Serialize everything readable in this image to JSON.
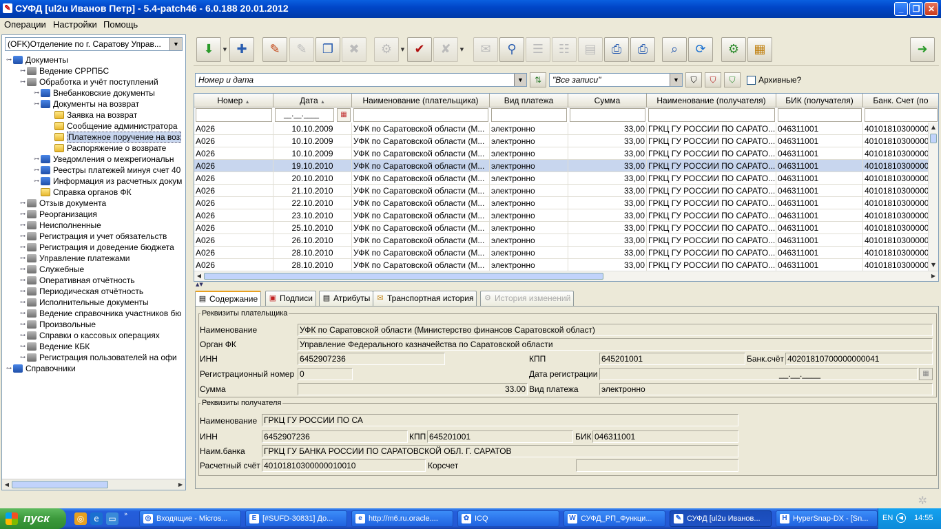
{
  "window": {
    "title": "СУФД [ul2u Иванов Петр] - 5.4-patch46 - 6.0.188 20.01.2012"
  },
  "menu": [
    "Операции",
    "Настройки",
    "Помощь"
  ],
  "left_panel": {
    "org_select": "(OFK)Отделение по г. Саратову Управ...",
    "tree": [
      {
        "label": "Документы",
        "level": 0,
        "icon": "doc"
      },
      {
        "label": "Ведение СРРПБС",
        "level": 1,
        "icon": "grp"
      },
      {
        "label": "Обработка и учёт поступлений",
        "level": 1,
        "icon": "grp"
      },
      {
        "label": "Внебанковские документы",
        "level": 2,
        "icon": "doc"
      },
      {
        "label": "Документы на возврат",
        "level": 2,
        "icon": "doc"
      },
      {
        "label": "Заявка на возврат",
        "level": 3,
        "icon": "folder"
      },
      {
        "label": "Сообщение администратора",
        "level": 3,
        "icon": "folder"
      },
      {
        "label": "Платежное поручение на воз",
        "level": 3,
        "icon": "folder",
        "selected": true
      },
      {
        "label": "Распоряжение о возврате",
        "level": 3,
        "icon": "folder"
      },
      {
        "label": "Уведомления о межрегиональн",
        "level": 2,
        "icon": "doc"
      },
      {
        "label": "Реестры платежей минуя счет 40",
        "level": 2,
        "icon": "doc"
      },
      {
        "label": "Информация из расчетных докум",
        "level": 2,
        "icon": "doc"
      },
      {
        "label": "Справка органов ФК",
        "level": 2,
        "icon": "folder"
      },
      {
        "label": "Отзыв документа",
        "level": 1,
        "icon": "grp"
      },
      {
        "label": "Реорганизация",
        "level": 1,
        "icon": "grp"
      },
      {
        "label": "Неисполненные",
        "level": 1,
        "icon": "grp"
      },
      {
        "label": "Регистрация и учет обязательств",
        "level": 1,
        "icon": "grp"
      },
      {
        "label": "Регистрация и доведение бюджета",
        "level": 1,
        "icon": "grp"
      },
      {
        "label": "Управление платежами",
        "level": 1,
        "icon": "grp"
      },
      {
        "label": "Служебные",
        "level": 1,
        "icon": "grp"
      },
      {
        "label": "Оперативная отчётность",
        "level": 1,
        "icon": "grp"
      },
      {
        "label": "Периодическая отчётность",
        "level": 1,
        "icon": "grp"
      },
      {
        "label": "Исполнительные документы",
        "level": 1,
        "icon": "grp"
      },
      {
        "label": "Ведение справочника участников бю",
        "level": 1,
        "icon": "grp"
      },
      {
        "label": "Произвольные",
        "level": 1,
        "icon": "grp"
      },
      {
        "label": "Справки о кассовых операциях",
        "level": 1,
        "icon": "grp"
      },
      {
        "label": "Ведение КБК",
        "level": 1,
        "icon": "grp"
      },
      {
        "label": "Регистрация пользователей на офи",
        "level": 1,
        "icon": "grp"
      },
      {
        "label": "Справочники",
        "level": 0,
        "icon": "doc"
      }
    ]
  },
  "filter": {
    "sort_combo": "Номер и дата",
    "records_combo": "\"Все записи\"",
    "archive_label": "Архивные?",
    "date_placeholder": "__.__.____"
  },
  "table": {
    "columns": [
      "Номер",
      "Дата",
      "Наименование (плательщика)",
      "Вид платежа",
      "Сумма",
      "Наименование (получателя)",
      "БИК (получателя)",
      "Банк. Счет (по"
    ],
    "rows": [
      [
        "А026",
        "10.10.2009",
        "УФК по Саратовской области (М...",
        "электронно",
        "33,00",
        "ГРКЦ ГУ РОССИИ ПО САРАТО...",
        "046311001",
        "40101810300000"
      ],
      [
        "А026",
        "10.10.2009",
        "УФК по Саратовской области (М...",
        "электронно",
        "33,00",
        "ГРКЦ ГУ РОССИИ ПО САРАТО...",
        "046311001",
        "40101810300000"
      ],
      [
        "А026",
        "10.10.2009",
        "УФК по Саратовской области (М...",
        "электронно",
        "33,00",
        "ГРКЦ ГУ РОССИИ ПО САРАТО...",
        "046311001",
        "40101810300000"
      ],
      [
        "А026",
        "19.10.2010",
        "УФК по Саратовской области (М...",
        "электронно",
        "33,00",
        "ГРКЦ ГУ РОССИИ ПО САРАТО...",
        "046311001",
        "40101810300000"
      ],
      [
        "А026",
        "20.10.2010",
        "УФК по Саратовской области (М...",
        "электронно",
        "33,00",
        "ГРКЦ ГУ РОССИИ ПО САРАТО...",
        "046311001",
        "40101810300000"
      ],
      [
        "А026",
        "21.10.2010",
        "УФК по Саратовской области (М...",
        "электронно",
        "33,00",
        "ГРКЦ ГУ РОССИИ ПО САРАТО...",
        "046311001",
        "40101810300000"
      ],
      [
        "А026",
        "22.10.2010",
        "УФК по Саратовской области (М...",
        "электронно",
        "33,00",
        "ГРКЦ ГУ РОССИИ ПО САРАТО...",
        "046311001",
        "40101810300000"
      ],
      [
        "А026",
        "23.10.2010",
        "УФК по Саратовской области (М...",
        "электронно",
        "33,00",
        "ГРКЦ ГУ РОССИИ ПО САРАТО...",
        "046311001",
        "40101810300000"
      ],
      [
        "А026",
        "25.10.2010",
        "УФК по Саратовской области (М...",
        "электронно",
        "33,00",
        "ГРКЦ ГУ РОССИИ ПО САРАТО...",
        "046311001",
        "40101810300000"
      ],
      [
        "А026",
        "26.10.2010",
        "УФК по Саратовской области (М...",
        "электронно",
        "33,00",
        "ГРКЦ ГУ РОССИИ ПО САРАТО...",
        "046311001",
        "40101810300000"
      ],
      [
        "А026",
        "28.10.2010",
        "УФК по Саратовской области (М...",
        "электронно",
        "33,00",
        "ГРКЦ ГУ РОССИИ ПО САРАТО...",
        "046311001",
        "40101810300000"
      ],
      [
        "А026",
        "28.10.2010",
        "УФК по Саратовской области (М...",
        "электронно",
        "33,00",
        "ГРКЦ ГУ РОССИИ ПО САРАТО...",
        "046311001",
        "40101810300000"
      ]
    ],
    "selected_row": 3
  },
  "tabs": [
    "Содержание",
    "Подписи",
    "Атрибуты",
    "Транспортная история",
    "История изменений"
  ],
  "payer": {
    "legend": "Реквизиты плательщика",
    "name_label": "Наименование",
    "name": "УФК по Саратовской области (Министерство финансов Саратовской област)",
    "org_label": "Орган ФК",
    "org": "Управление Федерального казначейства по Саратовской области",
    "inn_label": "ИНН",
    "inn": "6452907236",
    "kpp_label": "КПП",
    "kpp": "645201001",
    "account_label": "Банк.счёт",
    "account": "40201810700000000041",
    "regnum_label": "Регистрационный номер",
    "regnum": "0",
    "regdate_label": "Дата регистрации",
    "regdate": "__.__.____",
    "sum_label": "Сумма",
    "sum": "33.00",
    "paytype_label": "Вид платежа",
    "paytype": "электронно"
  },
  "recipient": {
    "legend": "Реквизиты получателя",
    "name_label": "Наименование",
    "name": "ГРКЦ ГУ РОССИИ ПО СА",
    "inn_label": "ИНН",
    "inn": "6452907236",
    "kpp_label": "КПП",
    "kpp": "645201001",
    "bik_label": "БИК",
    "bik": "046311001",
    "bank_label": "Наим.банка",
    "bank": "ГРКЦ ГУ БАНКА РОССИИ ПО САРАТОВСКОЙ ОБЛ. Г. САРАТОВ",
    "account_label": "Расчетный счёт",
    "account": "40101810300000010010",
    "corr_label": "Корсчет",
    "corr": ""
  },
  "taskbar": {
    "start": "пуск",
    "tasks": [
      "Входящие - Micros...",
      "[#SUFD-30831] До...",
      "http://m6.ru.oracle....",
      "ICQ",
      "СУФД_РП_Функци...",
      "СУФД [ul2u Иванов...",
      "HyperSnap-DX - [Sn..."
    ],
    "lang": "EN",
    "clock": "14:55"
  }
}
